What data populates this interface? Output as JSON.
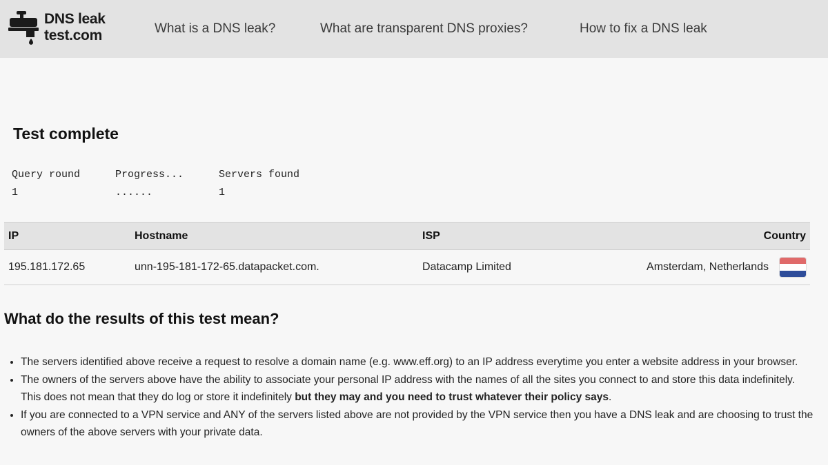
{
  "header": {
    "logo_line1": "DNS leak",
    "logo_line2": "test.com",
    "nav": [
      "What is a DNS leak?",
      "What are transparent DNS proxies?",
      "How to fix a DNS leak"
    ]
  },
  "status_title": "Test complete",
  "stats": {
    "query_round_label": "Query round",
    "query_round_value": "1",
    "progress_label": "Progress...",
    "progress_value": "......",
    "servers_found_label": "Servers found",
    "servers_found_value": "1"
  },
  "table": {
    "headers": [
      "IP",
      "Hostname",
      "ISP",
      "Country"
    ],
    "rows": [
      {
        "ip": "195.181.172.65",
        "hostname": "unn-195-181-172-65.datapacket.com.",
        "isp": "Datacamp Limited",
        "country": "Amsterdam, Netherlands",
        "flag_colors": [
          "#e06a6a",
          "#ffffff",
          "#2e4d9a"
        ]
      }
    ]
  },
  "explanation": {
    "title": "What do the results of this test mean?",
    "bullet1": "The servers identified above receive a request to resolve a domain name (e.g. www.eff.org) to an IP address everytime you enter a website address in your browser.",
    "bullet2_plain": "The owners of the servers above have the ability to associate your personal IP address with the names of all the sites you connect to and store this data indefinitely. This does not mean that they do log or store it indefinitely ",
    "bullet2_bold": "but they may and you need to trust whatever their policy says",
    "bullet2_end": ".",
    "bullet3": "If you are connected to a VPN service and ANY of the servers listed above are not provided by the VPN service then you have a DNS leak and are choosing to trust the owners of the above servers with your private data."
  },
  "colors": {
    "header_bg": "#e3e3e3",
    "page_bg": "#f7f7f7",
    "text": "#222222"
  }
}
